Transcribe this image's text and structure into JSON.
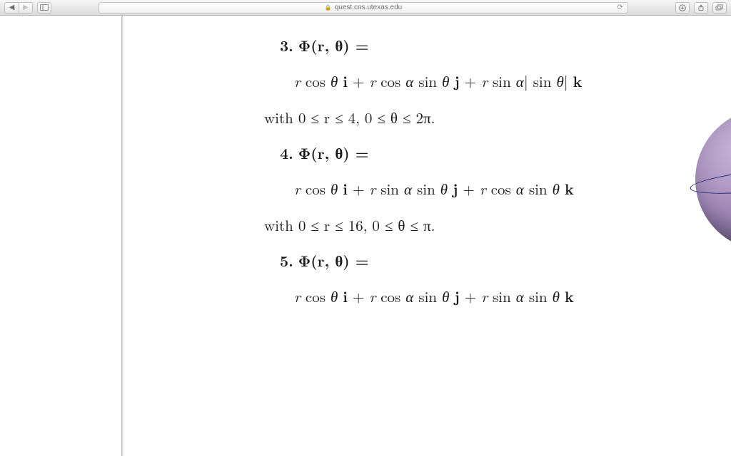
{
  "toolbar": {
    "url": "quest.cns.utexas.edu"
  },
  "content": {
    "item3": {
      "num": "3.",
      "head": "Φ(r, θ) =",
      "expr": "r cos θ i + r cos α sin θ j + r sin α| sin θ| k",
      "domain": "with 0 ≤ r ≤ 4,  0 ≤ θ ≤ 2π."
    },
    "item4": {
      "num": "4.",
      "head": "Φ(r, θ) =",
      "expr": "r cos θ i + r sin α sin θ j + r cos α sin θ k",
      "domain": "with 0 ≤ r ≤ 16,  0 ≤ θ ≤ π."
    },
    "item5": {
      "num": "5.",
      "head": "Φ(r, θ) =",
      "expr": "r cos θ i + r cos α sin θ j + r sin α sin θ k"
    }
  }
}
